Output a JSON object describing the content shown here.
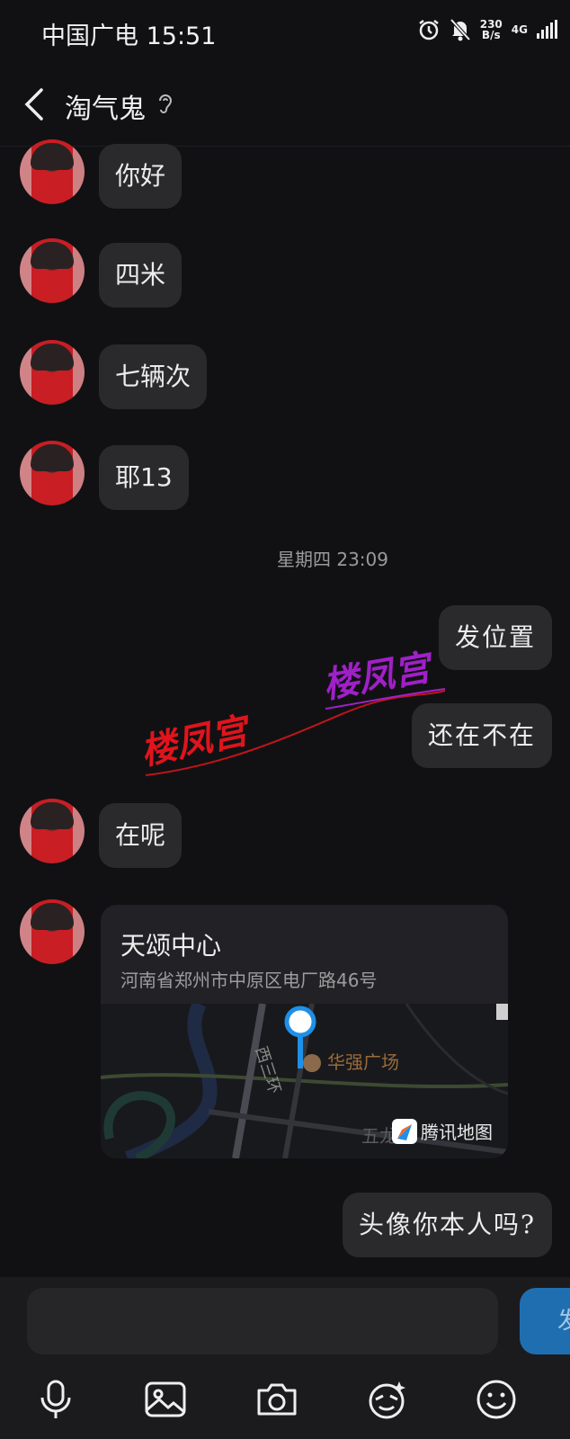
{
  "status_bar": {
    "carrier_time": "中国广电 15:51",
    "net_speed_top": "230",
    "net_speed_unit": "B/s",
    "network": "4G"
  },
  "header": {
    "title": "淘气鬼"
  },
  "messages": {
    "m1": "你好",
    "m2": "四米",
    "m3": "七辆次",
    "m4": "耶13",
    "time": "星期四 23:09",
    "m5": "发位置",
    "m6": "还在不在",
    "m7": "在呢",
    "m8": "头像你本人吗?"
  },
  "location": {
    "name": "天颂中心",
    "address": "河南省郑州市中原区电厂路46号",
    "poi": "华强广场",
    "road": "西三环",
    "road2": "五龙口",
    "provider": "腾讯地图"
  },
  "watermark": {
    "text1": "楼凤宫",
    "text2": "楼凤宫",
    "color1": "#e0141c",
    "color2": "#a020c8"
  },
  "input": {
    "placeholder": "",
    "send_label": "发送"
  },
  "colors": {
    "accent": "#1f6fb0",
    "bubble": "#2a2a2d",
    "background": "#111114"
  }
}
